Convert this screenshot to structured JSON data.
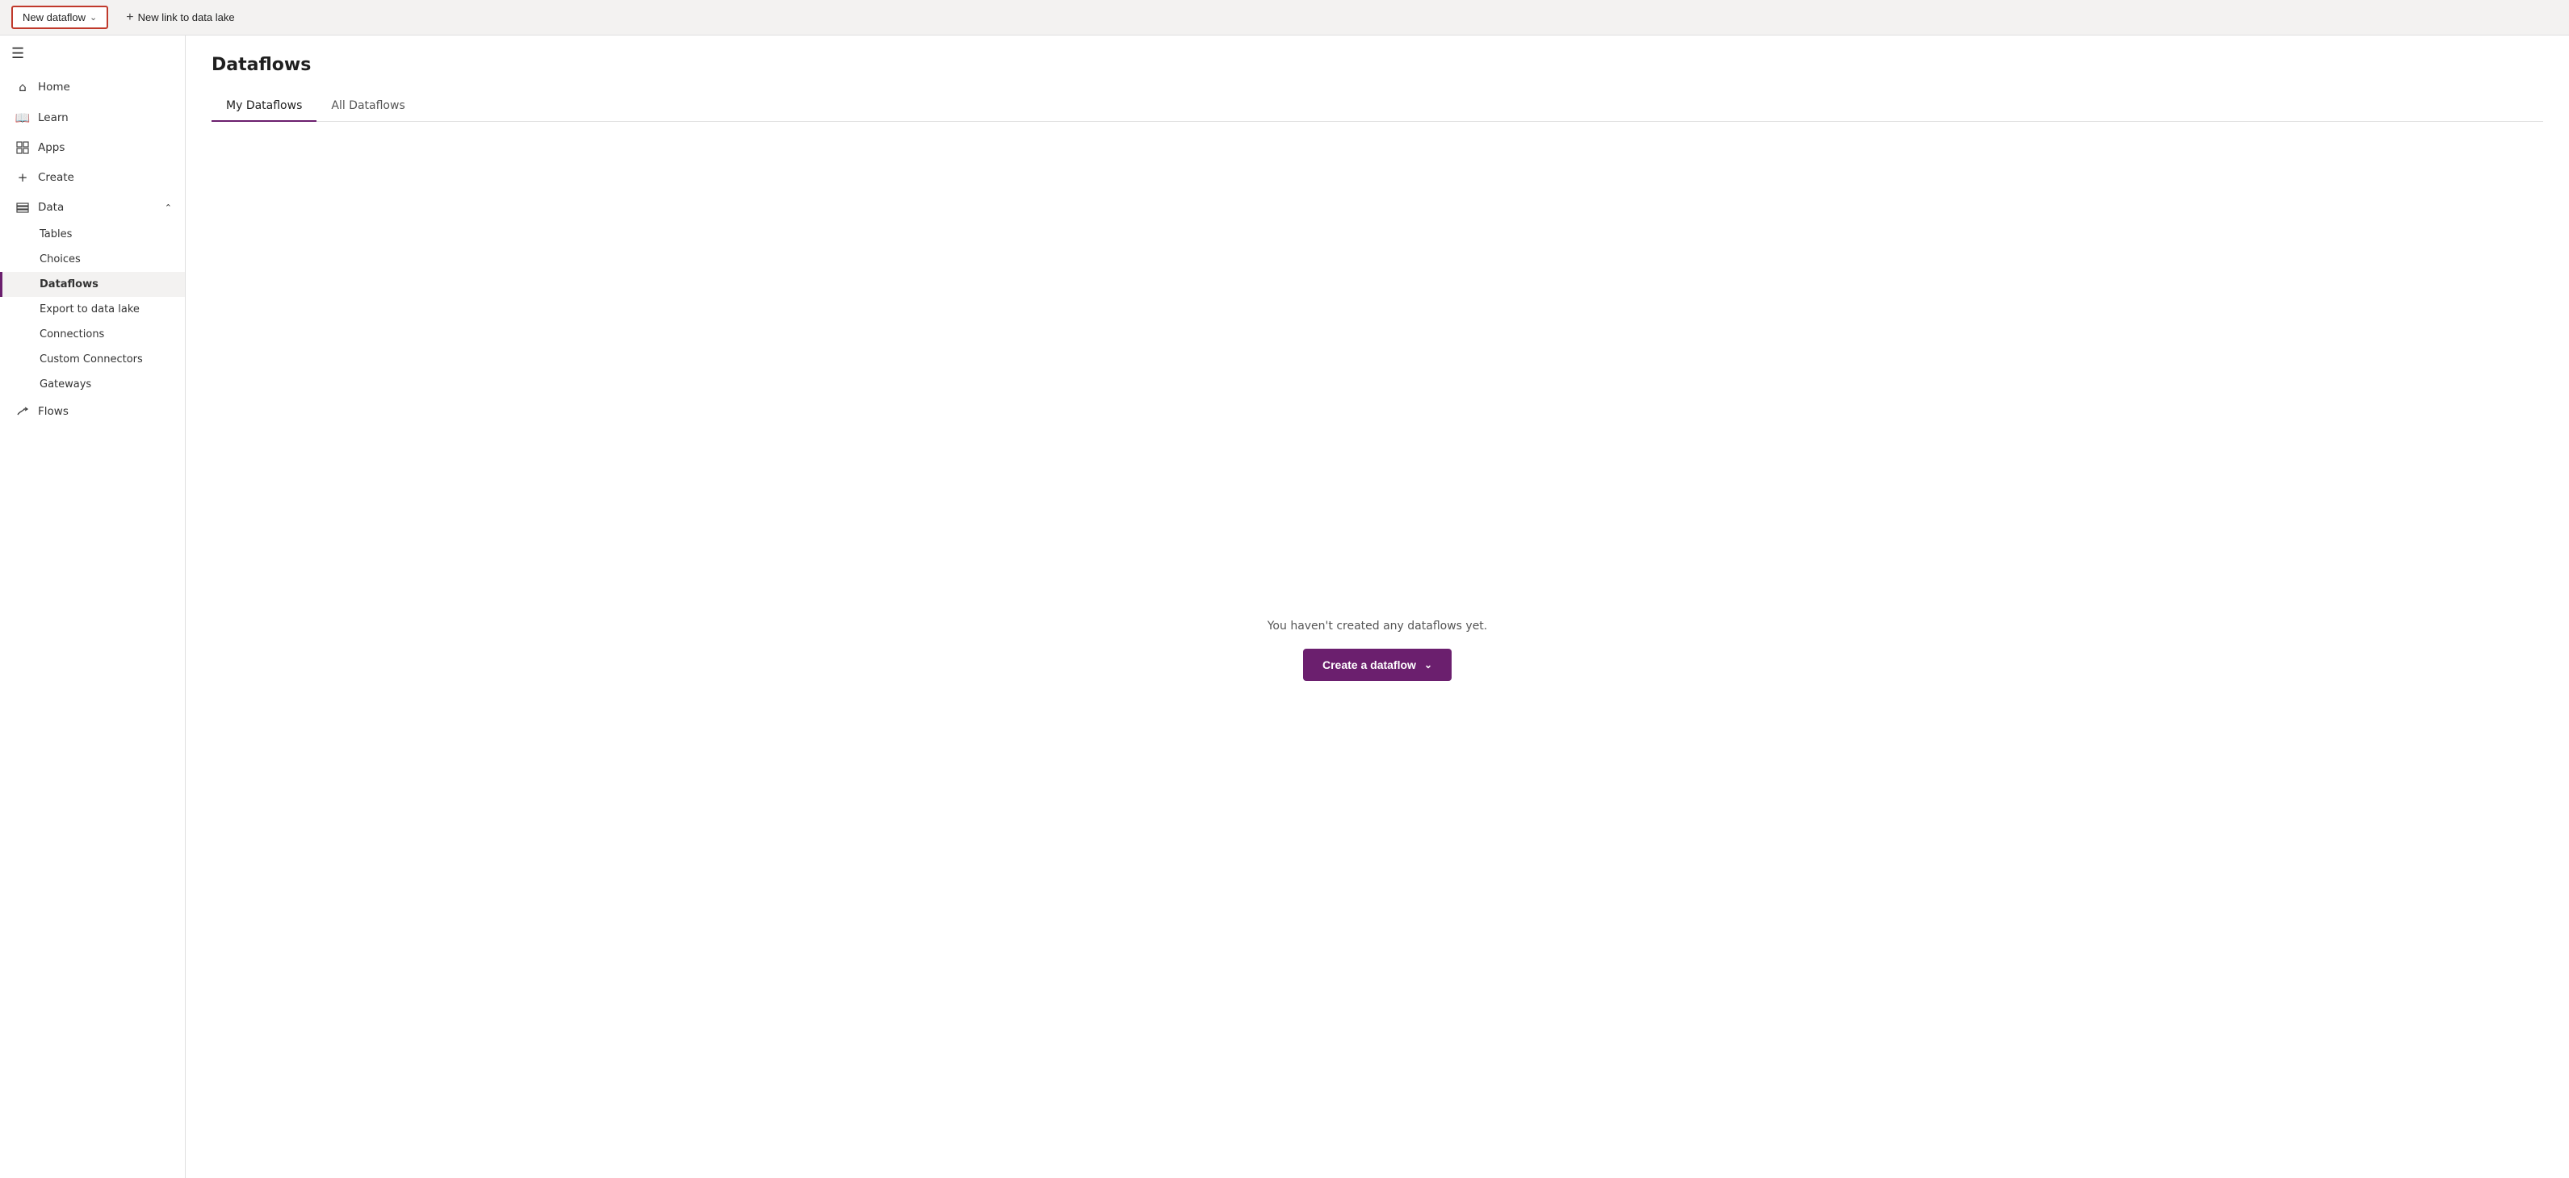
{
  "toolbar": {
    "new_dataflow_label": "New dataflow",
    "new_link_label": "New link to data lake"
  },
  "sidebar": {
    "hamburger_label": "☰",
    "nav_items": [
      {
        "id": "home",
        "label": "Home",
        "icon": "⌂"
      },
      {
        "id": "learn",
        "label": "Learn",
        "icon": "📖"
      },
      {
        "id": "apps",
        "label": "Apps",
        "icon": "⊞"
      },
      {
        "id": "create",
        "label": "Create",
        "icon": "+"
      },
      {
        "id": "data",
        "label": "Data",
        "icon": "⊞",
        "expandable": true,
        "expanded": true
      }
    ],
    "data_sub_items": [
      {
        "id": "tables",
        "label": "Tables"
      },
      {
        "id": "choices",
        "label": "Choices"
      },
      {
        "id": "dataflows",
        "label": "Dataflows",
        "active": true
      },
      {
        "id": "export",
        "label": "Export to data lake"
      },
      {
        "id": "connections",
        "label": "Connections"
      },
      {
        "id": "custom-connectors",
        "label": "Custom Connectors"
      },
      {
        "id": "gateways",
        "label": "Gateways"
      }
    ],
    "bottom_nav": [
      {
        "id": "flows",
        "label": "Flows",
        "icon": "↗"
      }
    ]
  },
  "main": {
    "page_title": "Dataflows",
    "tabs": [
      {
        "id": "my-dataflows",
        "label": "My Dataflows",
        "active": true
      },
      {
        "id": "all-dataflows",
        "label": "All Dataflows",
        "active": false
      }
    ],
    "empty_message": "You haven't created any dataflows yet.",
    "create_button_label": "Create a dataflow"
  }
}
